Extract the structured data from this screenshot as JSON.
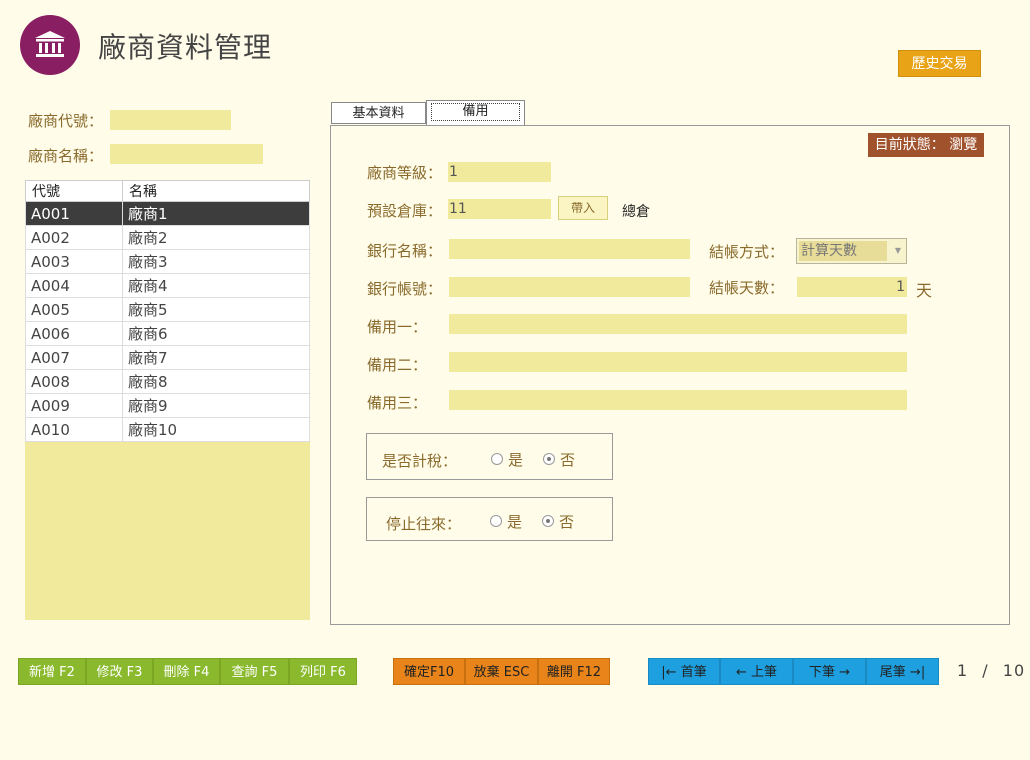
{
  "header": {
    "title": "廠商資料管理",
    "history_button": "歷史交易"
  },
  "search": {
    "vendor_code_label": "廠商代號：",
    "vendor_code_value": "",
    "vendor_name_label": "廠商名稱：",
    "vendor_name_value": ""
  },
  "vendor_list": {
    "columns": [
      "代號",
      "名稱"
    ],
    "rows": [
      [
        "A001",
        "廠商1"
      ],
      [
        "A002",
        "廠商2"
      ],
      [
        "A003",
        "廠商3"
      ],
      [
        "A004",
        "廠商4"
      ],
      [
        "A005",
        "廠商5"
      ],
      [
        "A006",
        "廠商6"
      ],
      [
        "A007",
        "廠商7"
      ],
      [
        "A008",
        "廠商8"
      ],
      [
        "A009",
        "廠商9"
      ],
      [
        "A010",
        "廠商10"
      ]
    ],
    "selected_index": 0
  },
  "tabs": [
    "基本資料",
    "備用"
  ],
  "active_tab": 1,
  "status_badge": "目前狀態： 瀏覽",
  "form": {
    "grade_label": "廠商等級：",
    "grade_value": "1",
    "warehouse_label": "預設倉庫：",
    "warehouse_value": "11",
    "import_button": "帶入",
    "warehouse_name": "總倉",
    "bank_name_label": "銀行名稱：",
    "bank_name_value": "",
    "settle_method_label": "結帳方式：",
    "settle_method_value": "計算天數",
    "bank_account_label": "銀行帳號：",
    "bank_account_value": "",
    "settle_days_label": "結帳天數：",
    "settle_days_value": "1",
    "days_unit": "天",
    "spare1_label": "備用一：",
    "spare1_value": "",
    "spare2_label": "備用二：",
    "spare2_value": "",
    "spare3_label": "備用三：",
    "spare3_value": "",
    "taxable_label": "是否計稅：",
    "inactive_label": "停止往來：",
    "yes_label": "是",
    "no_label": "否",
    "taxable_selected": "否",
    "inactive_selected": "否"
  },
  "buttons": {
    "add": "新增 F2",
    "edit": "修改 F3",
    "delete": "刪除 F4",
    "query": "查詢 F5",
    "print": "列印 F6",
    "confirm": "確定F10",
    "discard": "放棄 ESC",
    "exit": "離開 F12",
    "first": "|← 首筆",
    "prev": "← 上筆",
    "next": "下筆 →",
    "last": "尾筆 →|"
  },
  "pager": {
    "current": "1",
    "separator": "/",
    "total": "10"
  },
  "colors": {
    "logo": "#8a1e62",
    "field": "#f1ea9c",
    "status": "#a0522d",
    "green_button": "#8ab92d",
    "orange_button": "#e8841a",
    "blue_button": "#1ea0e0",
    "history_button": "#e8a317"
  }
}
